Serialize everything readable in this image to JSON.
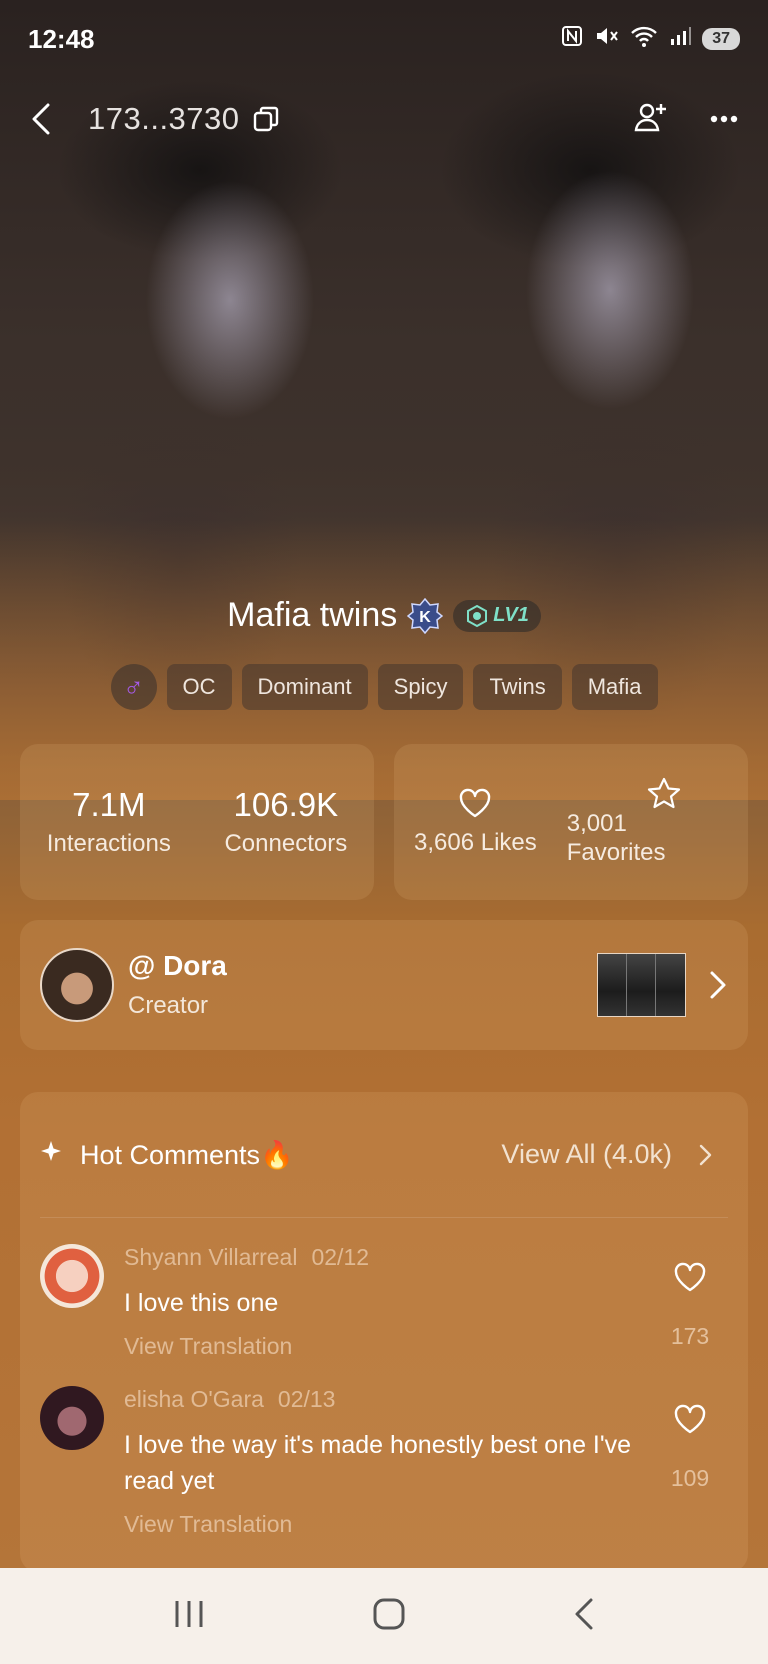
{
  "status_bar": {
    "time": "12:48",
    "battery": "37"
  },
  "header": {
    "id_text": "173...3730"
  },
  "character": {
    "name": "Mafia twins",
    "level": "LV1",
    "gender_symbol": "♂",
    "tags": [
      "OC",
      "Dominant",
      "Spicy",
      "Twins",
      "Mafia"
    ]
  },
  "stats": {
    "interactions_value": "7.1M",
    "interactions_label": "Interactions",
    "connectors_value": "106.9K",
    "connectors_label": "Connectors",
    "likes_label": "3,606 Likes",
    "favorites_label": "3,001 Favorites"
  },
  "creator": {
    "name": "@ Dora",
    "role": "Creator"
  },
  "comments_section": {
    "title": "Hot Comments🔥",
    "view_all": "View All (4.0k)",
    "items": [
      {
        "author": "Shyann Villarreal",
        "date": "02/12",
        "text": "I love this one",
        "translate": "View Translation",
        "likes": "173"
      },
      {
        "author": "elisha O'Gara",
        "date": "02/13",
        "text": "I love the way it's made honestly best one I've read yet",
        "translate": "View Translation",
        "likes": "109"
      }
    ]
  },
  "icons": {
    "back": "back-icon",
    "copy": "copy-icon",
    "add_friend": "add-friend-icon",
    "more": "more-icon",
    "heart": "heart-icon",
    "star": "star-icon",
    "sparkle": "sparkle-icon"
  },
  "colors": {
    "accent_level": "#7fe0c8",
    "gender": "#a55ae6"
  }
}
